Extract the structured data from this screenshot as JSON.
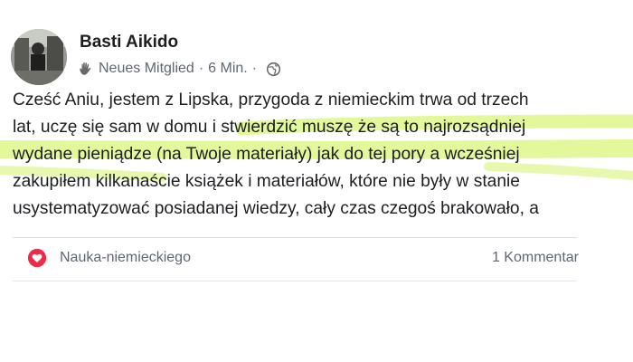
{
  "post": {
    "author": "Basti Aikido",
    "badge": "Neues Mitglied",
    "separator": "·",
    "time": "6 Min.",
    "audience_icon": "globe-icon",
    "badge_icon": "waving-hand-icon",
    "body_lines": [
      "Cześć Aniu, jestem z Lipska, przygoda z niemieckim trwa od trzech",
      "lat, uczę się sam w domu i stwierdzić muszę że są to najrozsądniej",
      "wydane pieniądze (na Twoje materiały) jak do tej pory a wcześniej",
      "zakupiłem kilkanaście książek i materiałów, które nie były w stanie",
      "usystematyzować posiadanej wiedzy, cały czas czegoś brakowało, a"
    ]
  },
  "footer": {
    "topic_icon": "heart-icon",
    "topic": "Nauka-niemieckiego",
    "comments": "1 Kommentar"
  },
  "colors": {
    "highlight": "#d9f57a",
    "text": "#1c1e21",
    "meta": "#606770",
    "heart": "#f02849"
  }
}
